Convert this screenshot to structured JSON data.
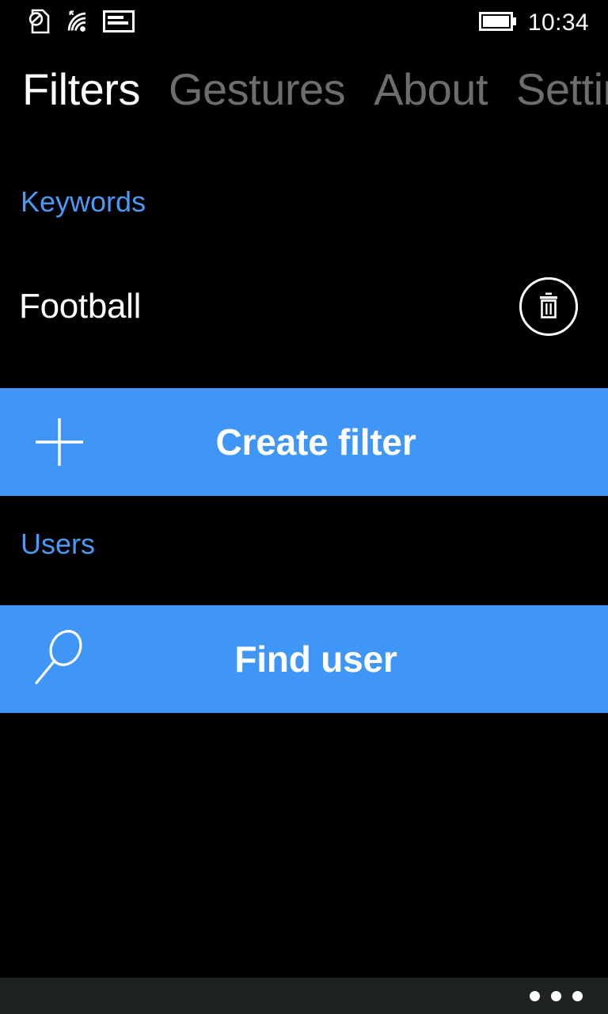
{
  "status_bar": {
    "icons": [
      "no-sim-icon",
      "wifi-signal-icon",
      "cellular-data-icon",
      "battery-full-icon"
    ],
    "time": "10:34",
    "battery_state": "full"
  },
  "header": {
    "tabs": [
      {
        "label": "Filters",
        "active": true
      },
      {
        "label": "Gestures",
        "active": false
      },
      {
        "label": "About",
        "active": false
      },
      {
        "label": "Settin",
        "active": false
      }
    ]
  },
  "sections": {
    "keywords": {
      "title": "Keywords",
      "items": [
        {
          "label": "Football",
          "delete_icon": "trash-icon"
        }
      ],
      "action": {
        "label": "Create filter",
        "icon": "plus-icon"
      }
    },
    "users": {
      "title": "Users",
      "action": {
        "label": "Find user",
        "icon": "search-icon"
      }
    }
  },
  "app_bar": {
    "more_label": "...",
    "more_icon": "ellipsis-icon"
  },
  "colors": {
    "background": "#000000",
    "accent": "#4a9af5",
    "band": "#4096f6",
    "text_primary": "#ffffff",
    "tab_inactive": "#6d6d6d",
    "app_bar": "#1e2223"
  }
}
